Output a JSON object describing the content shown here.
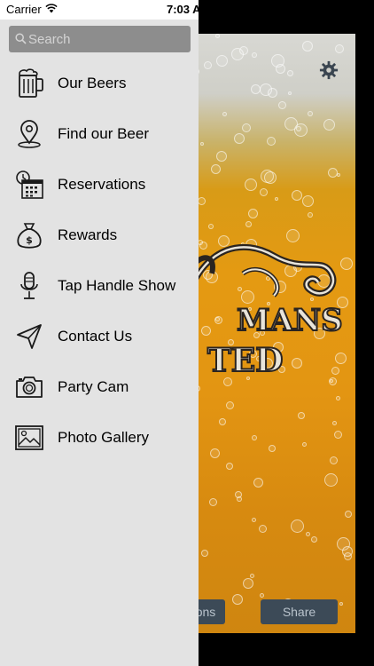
{
  "status_bar": {
    "carrier": "Carrier",
    "time": "7:03 A"
  },
  "search": {
    "placeholder": "Search"
  },
  "menu": {
    "items": [
      {
        "label": "Our Beers",
        "icon": "beer-mug-icon"
      },
      {
        "label": "Find our Beer",
        "icon": "map-pin-icon"
      },
      {
        "label": "Reservations",
        "icon": "calendar-clock-icon"
      },
      {
        "label": "Rewards",
        "icon": "money-bag-icon"
      },
      {
        "label": "Tap Handle Show",
        "icon": "microphone-icon"
      },
      {
        "label": "Contact Us",
        "icon": "paper-plane-icon"
      },
      {
        "label": "Party Cam",
        "icon": "camera-icon"
      },
      {
        "label": "Photo Gallery",
        "icon": "photo-icon"
      }
    ]
  },
  "background": {
    "logo_text_line1": "MANS",
    "logo_text_line2": "TED",
    "left_button_label": "ons",
    "share_button_label": "Share",
    "colors": {
      "beer_amber": "#e39512",
      "foam": "#d8d8d3",
      "button_bg": "#3c4a57"
    }
  },
  "colors": {
    "drawer_bg": "#e3e3e3",
    "search_bg": "#8d8d8d"
  }
}
